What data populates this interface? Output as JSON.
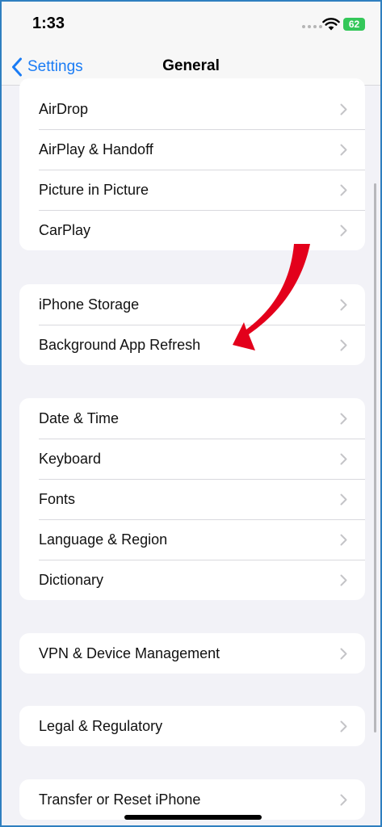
{
  "status_bar": {
    "time": "1:33",
    "battery_level": "62",
    "wifi_icon": "wifi-icon",
    "battery_color": "#34c759"
  },
  "nav": {
    "back_label": "Settings",
    "title": "General",
    "accent_color": "#1a7cf5"
  },
  "groups": [
    {
      "items": [
        "AirDrop",
        "AirPlay & Handoff",
        "Picture in Picture",
        "CarPlay"
      ]
    },
    {
      "items": [
        "iPhone Storage",
        "Background App Refresh"
      ]
    },
    {
      "items": [
        "Date & Time",
        "Keyboard",
        "Fonts",
        "Language & Region",
        "Dictionary"
      ]
    },
    {
      "items": [
        "VPN & Device Management"
      ]
    },
    {
      "items": [
        "Legal & Regulatory"
      ]
    },
    {
      "items": [
        "Transfer or Reset iPhone"
      ]
    }
  ],
  "annotation": {
    "arrow_color": "#e3001b",
    "points_to": "Background App Refresh"
  }
}
